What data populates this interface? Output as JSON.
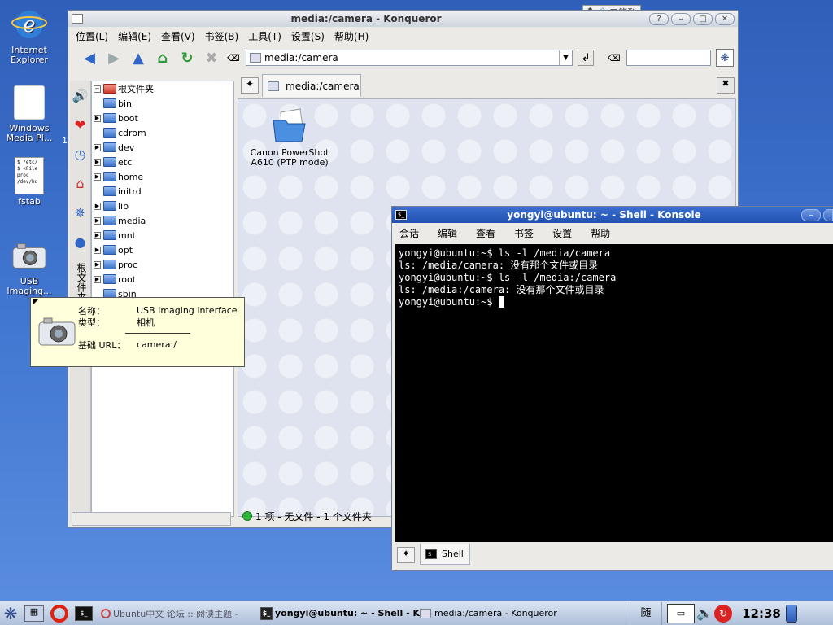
{
  "desktop": {
    "icons": [
      {
        "label": "Internet Explorer",
        "icon": "internet-explorer-icon"
      },
      {
        "label": "Windows Media Pl...",
        "icon": "media-player-icon"
      },
      {
        "label": "fstab",
        "icon": "text-file-icon",
        "preview": "$ /etc/\n$ <File\nproc\n/dev/hd"
      },
      {
        "label": "USB Imaging...",
        "icon": "camera-icon"
      }
    ],
    "stray_char": "1"
  },
  "konqueror": {
    "title": "media:/camera - Konqueror",
    "menu": [
      "位置(L)",
      "编辑(E)",
      "查看(V)",
      "书签(B)",
      "工具(T)",
      "设置(S)",
      "帮助(H)"
    ],
    "location": "media:/camera",
    "tab_label": "media:/camera",
    "tree_root": "根文件夹",
    "tree_items": [
      {
        "name": "bin",
        "expandable": false
      },
      {
        "name": "boot",
        "expandable": true
      },
      {
        "name": "cdrom",
        "expandable": false
      },
      {
        "name": "dev",
        "expandable": true
      },
      {
        "name": "etc",
        "expandable": true
      },
      {
        "name": "home",
        "expandable": true
      },
      {
        "name": "initrd",
        "expandable": false
      },
      {
        "name": "lib",
        "expandable": true
      },
      {
        "name": "media",
        "expandable": true
      },
      {
        "name": "mnt",
        "expandable": true
      },
      {
        "name": "opt",
        "expandable": true
      },
      {
        "name": "proc",
        "expandable": true
      },
      {
        "name": "root",
        "expandable": true
      },
      {
        "name": "sbin",
        "expandable": false
      }
    ],
    "side_tab_label": "根文件夹",
    "file_icon_label": "Canon PowerShot A610 (PTP mode)",
    "status": "1 项 - 无文件 - 1 个文件夹"
  },
  "tooltip": {
    "name_label": "名称：",
    "name_value": "USB Imaging Interface",
    "type_label": "类型：",
    "type_value": "相机",
    "url_label": "基础 URL：",
    "url_value": "camera:/"
  },
  "ime": {
    "label": "五笔型"
  },
  "konsole": {
    "title": "yongyi@ubuntu: ~ - Shell - Konsole",
    "menu": [
      "会话",
      "编辑",
      "查看",
      "书签",
      "设置",
      "帮助"
    ],
    "lines": [
      "yongyi@ubuntu:~$ ls -l /media/camera",
      "ls: /media/camera: 没有那个文件或目录",
      "yongyi@ubuntu:~$ ls -l /media:/camera",
      "ls: /media:/camera: 没有那个文件或目录",
      "yongyi@ubuntu:~$ "
    ],
    "tab_label": "Shell"
  },
  "taskbar": {
    "tasks": [
      {
        "label": "Ubuntu中文 论坛 :: 阅读主题 -",
        "active": false
      },
      {
        "label": "yongyi@ubuntu: ~ - Shell - K",
        "active": true
      },
      {
        "label": "media:/camera - Konqueror",
        "active": false
      }
    ],
    "ime_tray": "随",
    "clock": "12:38"
  }
}
